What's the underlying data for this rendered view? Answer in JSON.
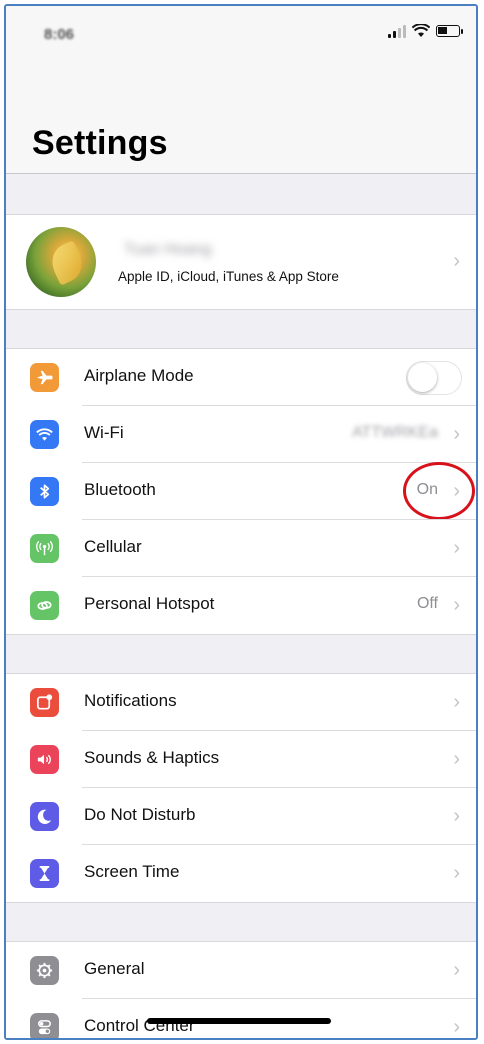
{
  "status_bar": {
    "time": "8:06"
  },
  "header": {
    "title": "Settings"
  },
  "profile": {
    "name": "Tuan Hoang",
    "subtitle": "Apple ID, iCloud, iTunes & App Store"
  },
  "groups": [
    [
      {
        "label": "Airplane Mode",
        "icon": "airplane-icon",
        "color": "#f19a37",
        "control": "toggle",
        "toggle_on": false
      },
      {
        "label": "Wi-Fi",
        "icon": "wifi-icon",
        "color": "#3478f6",
        "value": "ATTWRKEa"
      },
      {
        "label": "Bluetooth",
        "icon": "bluetooth-icon",
        "color": "#3478f6",
        "value": "On",
        "annotated": true
      },
      {
        "label": "Cellular",
        "icon": "antenna-icon",
        "color": "#65c466"
      },
      {
        "label": "Personal Hotspot",
        "icon": "hotspot-icon",
        "color": "#65c466",
        "value": "Off"
      }
    ],
    [
      {
        "label": "Notifications",
        "icon": "notifications-icon",
        "color": "#eb4d3d"
      },
      {
        "label": "Sounds & Haptics",
        "icon": "speaker-icon",
        "color": "#eb445a"
      },
      {
        "label": "Do Not Disturb",
        "icon": "moon-icon",
        "color": "#5e5ce6"
      },
      {
        "label": "Screen Time",
        "icon": "hourglass-icon",
        "color": "#5e5ce6"
      }
    ],
    [
      {
        "label": "General",
        "icon": "gear-icon",
        "color": "#8e8e93"
      },
      {
        "label": "Control Center",
        "icon": "switches-icon",
        "color": "#8e8e93"
      }
    ]
  ],
  "chevron": "›"
}
